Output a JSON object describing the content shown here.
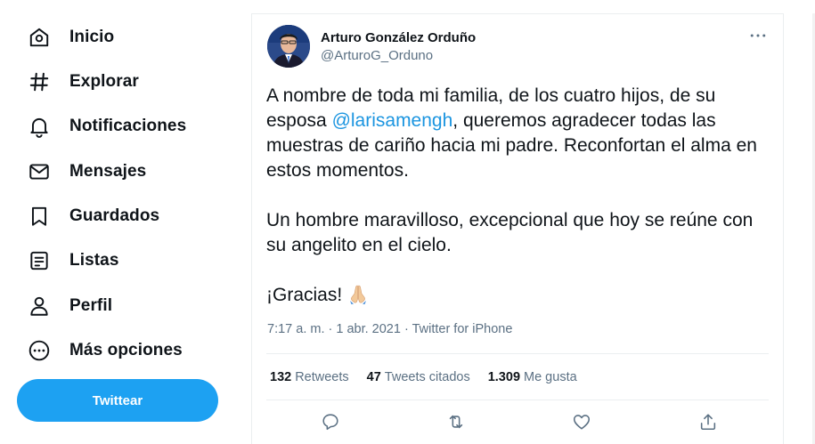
{
  "sidebar": {
    "items": [
      {
        "label": "Inicio",
        "icon": "home-icon"
      },
      {
        "label": "Explorar",
        "icon": "hashtag-icon"
      },
      {
        "label": "Notificaciones",
        "icon": "bell-icon"
      },
      {
        "label": "Mensajes",
        "icon": "envelope-icon"
      },
      {
        "label": "Guardados",
        "icon": "bookmark-icon"
      },
      {
        "label": "Listas",
        "icon": "list-icon"
      },
      {
        "label": "Perfil",
        "icon": "person-icon"
      },
      {
        "label": "Más opciones",
        "icon": "more-circle-icon"
      }
    ],
    "tweet_button": "Twittear"
  },
  "tweet": {
    "author_name": "Arturo González Orduño",
    "author_handle": "@ArturoG_Orduno",
    "text_part1": "A nombre de toda mi familia, de los cuatro hijos, de su esposa ",
    "mention": "@larisamengh",
    "text_part2": ", queremos agradecer todas las muestras de cariño hacia mi padre. Reconfortan el alma en estos momentos.",
    "paragraph2": "Un hombre maravilloso, excepcional que hoy se reúne con su angelito en el cielo.",
    "paragraph3": "¡Gracias!",
    "emoji": "folded-hands-icon",
    "time": "7:17 a. m.",
    "sep": " · ",
    "date": "1 abr. 2021",
    "source": "Twitter for iPhone",
    "stats": {
      "retweets_count": "132",
      "retweets_label": "Retweets",
      "quotes_count": "47",
      "quotes_label": "Tweets citados",
      "likes_count": "1.309",
      "likes_label": "Me gusta"
    }
  },
  "colors": {
    "accent": "#1da1f2",
    "link": "#1b95e0",
    "text": "#0f1419",
    "secondary": "#5b7083",
    "border": "#ebeef0"
  }
}
